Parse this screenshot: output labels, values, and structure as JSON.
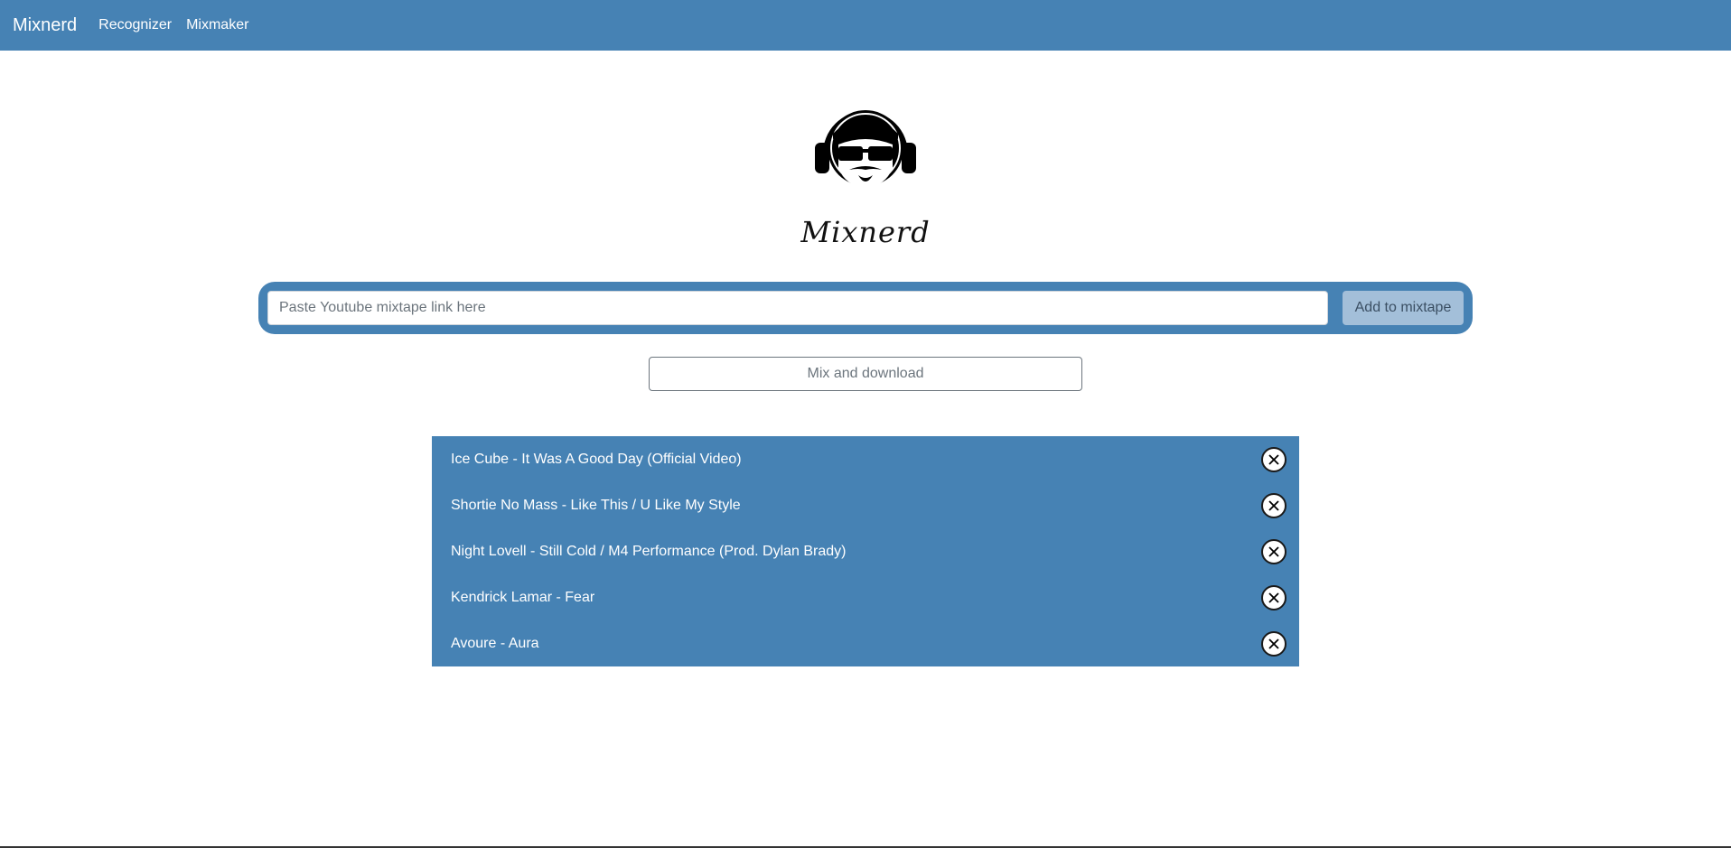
{
  "navbar": {
    "brand": "Mixnerd",
    "links": [
      {
        "label": "Recognizer"
      },
      {
        "label": "Mixmaker"
      }
    ]
  },
  "logo": {
    "text": "Mixnerd",
    "icon": "dj-headphones-face-icon"
  },
  "search": {
    "placeholder": "Paste Youtube mixtape link here",
    "value": "",
    "add_label": "Add to mixtape"
  },
  "mix_label": "Mix and download",
  "tracks": [
    {
      "title": "Ice Cube - It Was A Good Day (Official Video)"
    },
    {
      "title": "Shortie No Mass - Like This / U Like My Style"
    },
    {
      "title": "Night Lovell - Still Cold / M4 Performance (Prod. Dylan Brady)"
    },
    {
      "title": "Kendrick Lamar - Fear"
    },
    {
      "title": "Avoure - Aura"
    }
  ],
  "colors": {
    "primary": "#4682b4",
    "add_button_bg": "#a3bfd9",
    "background": "#ffffff"
  }
}
